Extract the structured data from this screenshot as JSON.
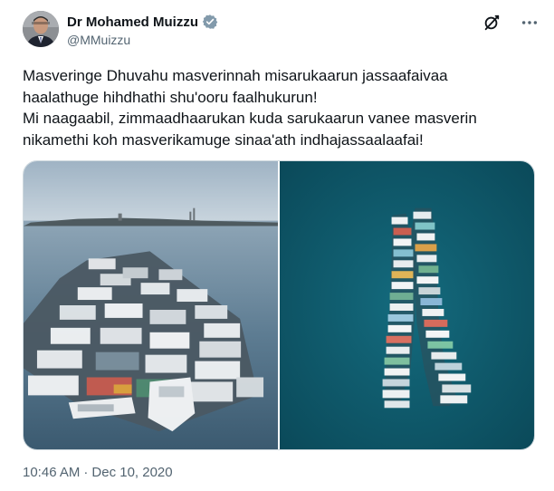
{
  "author": {
    "display_name": "Dr Mohamed Muizzu",
    "handle": "@MMuizzu",
    "avatar_icon": "person-avatar",
    "verified_icon": "verified-badge-icon",
    "verified_color": "#829aab"
  },
  "actions": {
    "grok_icon": "grok-slash-icon",
    "more_icon": "more-options-icon"
  },
  "tweet": {
    "lines": [
      "Masveringe Dhuvahu masverinnah misarukaarun jassaafaivaa",
      "haalathuge hihdhathi shu'ooru faalhukurun!",
      "Mi naagaabil, zimmaadhaarukan kuda sarukaarun vanee masverin",
      "nikamethi koh masverikamuge sinaa'ath indhajassaalaafai!"
    ]
  },
  "media": [
    {
      "alt": "boats-lined-up-harbor-photo"
    },
    {
      "alt": "aerial-boats-formation-photo"
    }
  ],
  "meta": {
    "time": "10:46 AM",
    "separator": "·",
    "date": "Dec 10, 2020"
  },
  "colors": {
    "text": "#0f1419",
    "secondary": "#536471",
    "border": "#cfd9de",
    "sea_dark": "#0d4d5e",
    "sea_light": "#6d8ea3"
  }
}
